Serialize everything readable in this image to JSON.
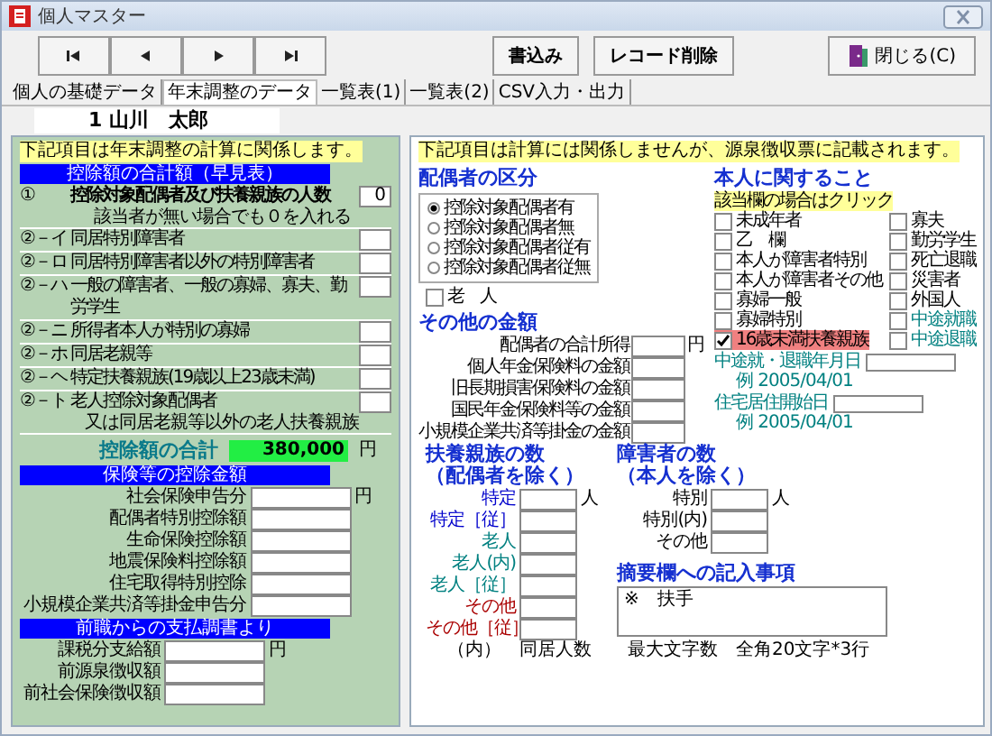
{
  "window": {
    "title": "個人マスター"
  },
  "toolbar": {
    "nav_buttons": [
      {
        "kind": "first"
      },
      {
        "kind": "prev"
      },
      {
        "kind": "next"
      },
      {
        "kind": "last"
      }
    ],
    "buttons": [
      {
        "label": "書込み",
        "kind": "action"
      },
      {
        "label": "レコード削除",
        "kind": "action"
      },
      {
        "label": "閉じる(C)",
        "kind": "close"
      }
    ]
  },
  "tabs": [
    {
      "label": "個人の基礎データ",
      "selected": false
    },
    {
      "label": "年末調整のデータ",
      "selected": true
    },
    {
      "label": "一覧表(1)",
      "selected": false
    },
    {
      "label": "一覧表(2)",
      "selected": false
    },
    {
      "label": "CSV入力・出力",
      "selected": false
    }
  ],
  "employee": "1 山川　太郎",
  "left_panel": {
    "note": "下記項目は年末調整の計算に関係します。",
    "summary": {
      "title": "控除額の合計額（早見表）",
      "rows": [
        {
          "no": "①",
          "label": "控除対象配偶者及び扶養親族の人数",
          "sublabel": "該当者が無い場合でも０を入れる",
          "value": "0"
        },
        {
          "no": "②－イ",
          "label": "同居特別障害者"
        },
        {
          "no": "②－ロ",
          "label": "同居特別障害者以外の特別障害者"
        },
        {
          "no": "②－ハ",
          "label": "一般の障害者、一般の寡婦、寡夫、勤労学生"
        },
        {
          "no": "②－ニ",
          "label": "所得者本人が特別の寡婦"
        },
        {
          "no": "②－ホ",
          "label": "同居老親等"
        },
        {
          "no": "②－ヘ",
          "label": "特定扶養親族(19歳以上23歳未満)"
        },
        {
          "no": "②－ト",
          "label": "老人控除対象配偶者",
          "sublabel": "又は同居老親等以外の老人扶養親族"
        }
      ],
      "total_label": "控除額の合計",
      "total_value": "380,000",
      "unit": "円"
    },
    "insurance": {
      "title": "保険等の控除金額",
      "rows": [
        "社会保険申告分",
        "配偶者特別控除額",
        "生命保険控除額",
        "地震保険料控除額",
        "住宅取得特別控除",
        "小規模企業共済等掛金申告分"
      ],
      "unit": "円"
    },
    "previous": {
      "title": "前職からの支払調書より",
      "rows": [
        "課税分支給額",
        "前源泉徴収額",
        "前社会保険徴収額"
      ],
      "unit": "円"
    }
  },
  "right_panel": {
    "note": "下記項目は計算には関係しませんが、源泉徴収票に記載されます。",
    "spouse": {
      "title": "配偶者の区分",
      "options": [
        {
          "label": "控除対象配偶者有",
          "selected": true
        },
        {
          "label": "控除対象配偶者無",
          "selected": false
        },
        {
          "label": "控除対象配偶者従有",
          "selected": false
        },
        {
          "label": "控除対象配偶者従無",
          "selected": false
        }
      ],
      "elderly": {
        "label": "老　人",
        "checked": false
      }
    },
    "other": {
      "title": "その他の金額",
      "rows": [
        "配偶者の合計所得",
        "個人年金保険料の金額",
        "旧長期損害保険料の金額",
        "国民年金保険料等の金額",
        "小規模企業共済等掛金の金額"
      ],
      "unit": "円"
    },
    "self": {
      "title": "本人に関すること",
      "hint": "該当欄の場合はクリック",
      "column_1": [
        {
          "label": "未成年者",
          "checked": false
        },
        {
          "label": "乙　欄",
          "checked": false
        },
        {
          "label": "本人が障害者特別",
          "checked": false
        },
        {
          "label": "本人が障害者その他",
          "checked": false
        },
        {
          "label": "寡婦一般",
          "checked": false
        },
        {
          "label": "寡婦特別",
          "checked": false
        },
        {
          "label": "16歳未満扶養親族",
          "checked": true
        }
      ],
      "column_2": [
        {
          "label": "寡夫",
          "checked": false,
          "color": "#000000"
        },
        {
          "label": "勤労学生",
          "checked": false,
          "color": "#000000"
        },
        {
          "label": "死亡退職",
          "checked": false,
          "color": "#000000"
        },
        {
          "label": "災害者",
          "checked": false,
          "color": "#000000"
        },
        {
          "label": "外国人",
          "checked": false,
          "color": "#000000"
        },
        {
          "label": "中途就職",
          "checked": false,
          "color": "#008080"
        },
        {
          "label": "中途退職",
          "checked": false,
          "color": "#008080"
        }
      ]
    },
    "dates": [
      {
        "label": "中途就・退職年月日",
        "example": "例 2005/04/01"
      },
      {
        "label": "住宅居住開始日",
        "example": "例 2005/04/01"
      }
    ],
    "dependents": {
      "title": "扶養親族の数",
      "subtitle": "（配偶者を除く）",
      "rows": [
        {
          "label": "特定",
          "color": "#0000cc"
        },
        {
          "label": "特定［従］",
          "color": "#0000cc"
        },
        {
          "label": "老人",
          "color": "#008080"
        },
        {
          "label": "老人(内)",
          "color": "#008080"
        },
        {
          "label": "老人［従］",
          "color": "#008080"
        },
        {
          "label": "その他",
          "color": "#aa0000"
        },
        {
          "label": "その他［従］",
          "color": "#aa0000"
        }
      ],
      "unit": "人",
      "footnote": "（内）　同居人数"
    },
    "disabled": {
      "title": "障害者の数",
      "subtitle": "（本人を除く）",
      "rows": [
        "特別",
        "特別(内)",
        "その他"
      ],
      "unit": "人"
    },
    "remarks": {
      "title": "摘要欄への記入事項",
      "value": "※　扶手",
      "limit": "最大文字数　全角20文字*3行"
    }
  }
}
